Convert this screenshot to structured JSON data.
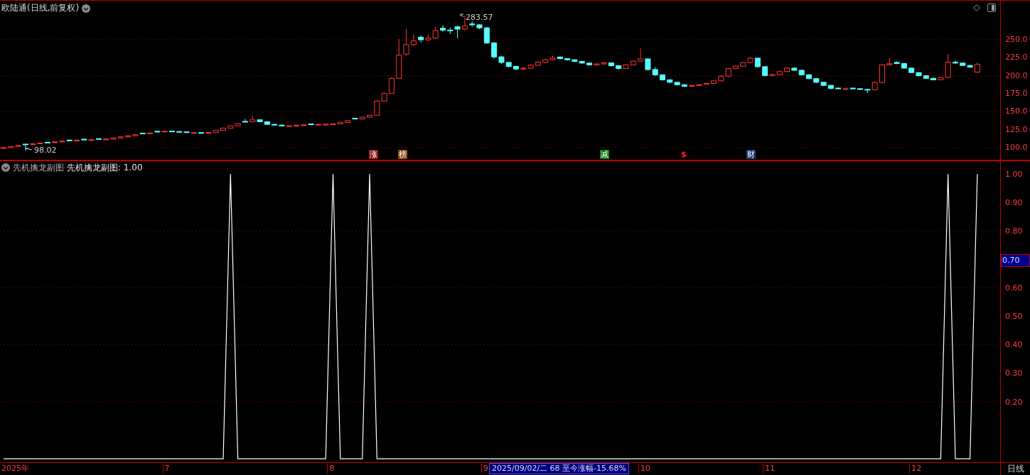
{
  "window": {
    "title": "欧陆通(日线,前复权)"
  },
  "price_panel": {
    "chart_data": {
      "type": "candlestick",
      "ylim": [
        82.2,
        304.3
      ],
      "yticks": [
        {
          "value": 250,
          "label": "250.0"
        },
        {
          "value": 225,
          "label": "225.0"
        },
        {
          "value": 200,
          "label": "200.0"
        },
        {
          "value": 175,
          "label": "175.0"
        },
        {
          "value": 150,
          "label": "150.0"
        },
        {
          "value": 125,
          "label": "125.0"
        },
        {
          "value": 100,
          "label": "100.0"
        }
      ],
      "grid": true,
      "ohlc": [
        [
          99.5,
          101,
          98.5,
          100
        ],
        [
          100,
          102.5,
          99.5,
          101.5
        ],
        [
          102,
          103.5,
          101.5,
          102.9
        ],
        [
          104.9,
          105.5,
          98.02,
          104.4
        ],
        [
          104.4,
          106.5,
          103.8,
          105.5
        ],
        [
          105.5,
          107.2,
          104.8,
          106.4
        ],
        [
          107.5,
          108,
          106.5,
          107.2
        ],
        [
          107.2,
          109,
          106.6,
          108.1
        ],
        [
          108.1,
          110,
          107.5,
          109
        ],
        [
          110.5,
          111,
          109.2,
          109.8
        ],
        [
          109.8,
          111.2,
          109.2,
          110.3
        ],
        [
          111.8,
          112.3,
          110.2,
          110.7
        ],
        [
          110.7,
          112,
          110.1,
          111.1
        ],
        [
          112.5,
          113,
          111,
          111.6
        ],
        [
          111.6,
          113,
          111,
          112
        ],
        [
          112,
          114.3,
          111.6,
          113.4
        ],
        [
          113.4,
          116,
          113,
          115
        ],
        [
          115,
          117.2,
          114.5,
          116.5
        ],
        [
          116.5,
          119,
          116,
          118
        ],
        [
          120.2,
          121,
          118.8,
          119.3
        ],
        [
          119.3,
          121.5,
          118.8,
          120.6
        ],
        [
          122.8,
          123.5,
          121.3,
          121.9
        ],
        [
          121.9,
          123.8,
          121.3,
          123
        ],
        [
          123,
          123.6,
          121.8,
          122.4
        ],
        [
          122.4,
          123,
          121.2,
          121.9
        ],
        [
          121.9,
          122.5,
          120.8,
          121.4
        ],
        [
          120,
          121.6,
          119.5,
          120.9
        ],
        [
          120.9,
          121.5,
          119.7,
          120.3
        ],
        [
          120.3,
          121.8,
          119.8,
          121
        ],
        [
          121,
          125,
          120.5,
          124
        ],
        [
          124,
          128,
          123.5,
          127.2
        ],
        [
          127.2,
          131,
          126.8,
          130.3
        ],
        [
          130.3,
          134,
          129.8,
          133.2
        ],
        [
          136.5,
          140,
          135,
          136
        ],
        [
          136,
          144.5,
          135.5,
          138.7
        ],
        [
          138.7,
          139.2,
          135.5,
          136.1
        ],
        [
          136.1,
          136.8,
          131.8,
          132.4
        ],
        [
          132.4,
          133,
          130.8,
          131.4
        ],
        [
          131.4,
          132,
          129.6,
          130.2
        ],
        [
          129.5,
          131,
          129,
          130.4
        ],
        [
          130.4,
          131.8,
          129.8,
          131.1
        ],
        [
          131.1,
          132.5,
          130.6,
          131.8
        ],
        [
          133,
          133.6,
          131.6,
          132.2
        ],
        [
          132.2,
          133,
          131.8,
          132.4
        ],
        [
          131.5,
          133.2,
          131,
          132.7
        ],
        [
          132.7,
          133.6,
          132.2,
          133
        ],
        [
          133,
          136,
          132.5,
          135.1
        ],
        [
          135.1,
          138.4,
          134.6,
          137.5
        ],
        [
          140.8,
          141.3,
          139.3,
          139.9
        ],
        [
          139.9,
          143.2,
          139.4,
          142.4
        ],
        [
          142.4,
          146,
          141.8,
          145
        ],
        [
          145,
          166,
          144.5,
          164.8
        ],
        [
          164.8,
          176.5,
          164,
          175.6
        ],
        [
          175.6,
          198,
          175,
          196.4
        ],
        [
          196.4,
          251,
          195.5,
          228.6
        ],
        [
          230,
          265,
          228,
          243.3
        ],
        [
          243.3,
          258,
          241,
          248.4
        ],
        [
          253.5,
          256,
          246,
          250
        ],
        [
          250,
          257,
          248,
          252.4
        ],
        [
          252.4,
          268,
          251,
          262.7
        ],
        [
          266,
          270,
          261,
          263.4
        ],
        [
          263.4,
          267,
          258,
          262.7
        ],
        [
          268,
          270,
          252,
          264.8
        ],
        [
          264.8,
          283.57,
          263,
          269.5
        ],
        [
          272,
          276,
          268,
          270.8
        ],
        [
          270.8,
          272,
          265,
          266.6
        ],
        [
          266.6,
          268,
          244,
          245.6
        ],
        [
          245.6,
          247,
          224,
          226.2
        ],
        [
          226.2,
          228,
          216,
          218.5
        ],
        [
          218.5,
          219,
          211,
          213
        ],
        [
          213,
          214,
          207.5,
          209.4
        ],
        [
          209.4,
          211.5,
          208,
          210.5
        ],
        [
          210.5,
          216,
          209.5,
          214.6
        ],
        [
          214.6,
          220,
          213.8,
          218.8
        ],
        [
          218.8,
          223.5,
          217.8,
          222.2
        ],
        [
          222.2,
          228,
          221.5,
          224.4
        ],
        [
          226,
          227,
          222.8,
          223.8
        ],
        [
          223.8,
          224.5,
          221,
          222.2
        ],
        [
          222.2,
          223,
          218.5,
          220
        ],
        [
          220,
          221,
          216.5,
          217.6
        ],
        [
          217.6,
          218.5,
          214,
          215.2
        ],
        [
          215.2,
          217.5,
          214.5,
          216.4
        ],
        [
          216.4,
          219,
          215.5,
          217.9
        ],
        [
          217.9,
          218.5,
          212.5,
          214
        ],
        [
          214,
          215,
          208.5,
          210.1
        ],
        [
          210.1,
          216,
          209.5,
          215.1
        ],
        [
          215.1,
          221,
          214.5,
          220.3
        ],
        [
          220.3,
          238,
          219,
          223.4
        ],
        [
          223.4,
          224,
          207,
          208.6
        ],
        [
          208.6,
          212,
          200,
          201.2
        ],
        [
          201.2,
          202,
          193,
          194.3
        ],
        [
          194.3,
          195,
          189.5,
          190.9
        ],
        [
          190.9,
          191.5,
          186.5,
          187.5
        ],
        [
          187.5,
          188.5,
          184,
          185.3
        ],
        [
          185.3,
          187.2,
          184.6,
          186.3
        ],
        [
          186.3,
          188.2,
          185.6,
          187.4
        ],
        [
          188.5,
          190,
          188,
          189.3
        ],
        [
          189.3,
          193.8,
          188.6,
          192.9
        ],
        [
          192.9,
          200.5,
          192,
          199.4
        ],
        [
          199.4,
          211,
          198.5,
          209.9
        ],
        [
          209.9,
          214.5,
          209,
          213.3
        ],
        [
          213.3,
          219.5,
          212.5,
          218.3
        ],
        [
          218.3,
          226,
          217,
          224.4
        ],
        [
          224.4,
          225,
          211,
          212.6
        ],
        [
          212.6,
          213.5,
          199,
          200.3
        ],
        [
          200.3,
          203,
          199.5,
          201.6
        ],
        [
          201.6,
          207,
          201,
          205.8
        ],
        [
          205.8,
          212,
          205,
          210.6
        ],
        [
          210.6,
          211.5,
          206.5,
          207.6
        ],
        [
          207.6,
          208.5,
          200,
          201.4
        ],
        [
          201.4,
          202,
          195,
          196
        ],
        [
          196,
          197,
          189.5,
          190.9
        ],
        [
          190.9,
          191.5,
          185.5,
          186.6
        ],
        [
          186.6,
          187.5,
          181,
          182.4
        ],
        [
          182.8,
          183.6,
          181,
          182
        ],
        [
          181.2,
          182.8,
          180.5,
          182
        ],
        [
          182.8,
          183.2,
          181,
          182
        ],
        [
          182,
          182.6,
          180,
          181
        ],
        [
          181,
          181.6,
          176,
          180.4
        ],
        [
          180.4,
          192,
          180,
          190.7
        ],
        [
          190.7,
          216.5,
          190,
          215.2
        ],
        [
          215.2,
          225,
          214.5,
          216.7
        ],
        [
          218.5,
          220,
          216,
          217
        ],
        [
          217,
          217.8,
          209.5,
          210.6
        ],
        [
          210.6,
          211.5,
          203.5,
          204.4
        ],
        [
          204.4,
          205,
          199,
          200
        ],
        [
          200,
          201,
          195.5,
          196.4
        ],
        [
          196.4,
          197.5,
          193.5,
          194.4
        ],
        [
          194.4,
          198.5,
          193.8,
          197.7
        ],
        [
          197.7,
          230,
          197,
          218.8
        ],
        [
          218.8,
          221,
          216.5,
          217.6
        ],
        [
          217.6,
          218.4,
          213.5,
          214.3
        ],
        [
          214.3,
          215,
          211,
          212
        ],
        [
          205,
          218,
          204,
          216
        ]
      ]
    },
    "annotations": [
      {
        "kind": "high",
        "text": "283.57"
      },
      {
        "kind": "low",
        "text": "98.02"
      }
    ],
    "markers": [
      {
        "kind": "tag",
        "text": "涨",
        "color": "#8c1414"
      },
      {
        "kind": "tag",
        "text": "榜",
        "color": "#8c4a14"
      },
      {
        "kind": "tag",
        "text": "减",
        "color": "#117a11"
      },
      {
        "kind": "symbol",
        "text": "$",
        "color": "#ff2222"
      },
      {
        "kind": "tag",
        "text": "财",
        "color": "#1c3c78"
      }
    ]
  },
  "indicator_panel": {
    "value_label": "先机擒龙副图: 1.00",
    "cursor_value": "0.70",
    "chart_data": {
      "type": "line",
      "ylim": [
        -0.057,
        1.047
      ],
      "grid": true,
      "yticks": [
        {
          "value": 1,
          "label": "1.00"
        },
        {
          "value": 0.9,
          "label": "0.90"
        },
        {
          "value": 0.8,
          "label": "0.80"
        },
        {
          "value": 0.6,
          "label": "0.60"
        },
        {
          "value": 0.5,
          "label": "0.50"
        },
        {
          "value": 0.4,
          "label": "0.40"
        },
        {
          "value": 0.3,
          "label": "0.30"
        },
        {
          "value": 0.2,
          "label": "0.20"
        }
      ],
      "series": [
        {
          "name": "先机擒龙副图",
          "color": "#ffffff",
          "values": [
            0,
            0,
            0,
            0,
            0,
            0,
            0,
            0,
            0,
            0,
            0,
            0,
            0,
            0,
            0,
            0,
            0,
            0,
            0,
            0,
            0,
            0,
            0,
            0,
            0,
            0,
            0,
            0,
            0,
            0,
            0,
            1,
            0,
            0,
            0,
            0,
            0,
            0,
            0,
            0,
            0,
            0,
            0,
            0,
            0,
            1,
            0,
            0,
            0,
            0,
            1,
            0,
            0,
            0,
            0,
            0,
            0,
            0,
            0,
            0,
            0,
            0,
            0,
            0,
            0,
            0,
            0,
            0,
            0,
            0,
            0,
            0,
            0,
            0,
            0,
            0,
            0,
            0,
            0,
            0,
            0,
            0,
            0,
            0,
            0,
            0,
            0,
            0,
            0,
            0,
            0,
            0,
            0,
            0,
            0,
            0,
            0,
            0,
            0,
            0,
            0,
            0,
            0,
            0,
            0,
            0,
            0,
            0,
            0,
            0,
            0,
            0,
            0,
            0,
            0,
            0,
            0,
            0,
            0,
            0,
            0,
            0,
            0,
            0,
            0,
            0,
            0,
            0,
            0,
            1,
            0,
            0,
            0,
            1
          ]
        }
      ]
    }
  },
  "time_axis": {
    "labels": [
      "2025年",
      "7",
      "8",
      "9",
      "10",
      "11",
      "12"
    ],
    "crosshair_info": "2025/09/02/二 68 至今涨幅-15.68%"
  },
  "timeframe": "日线"
}
